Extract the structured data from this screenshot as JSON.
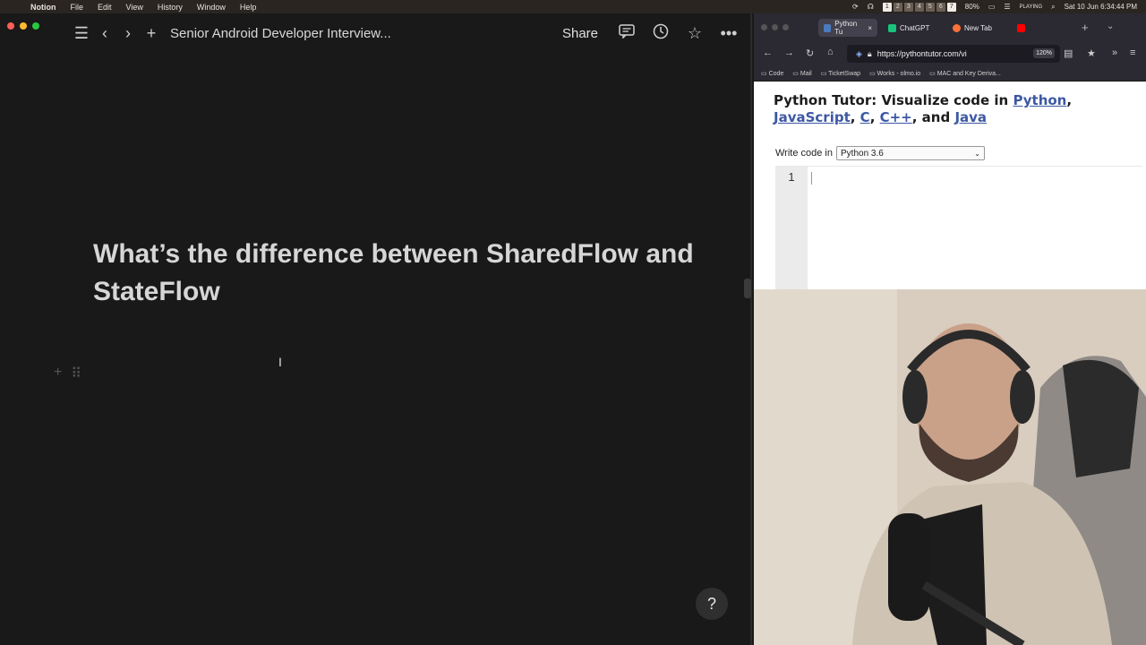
{
  "menubar": {
    "app": "Notion",
    "items": [
      "File",
      "Edit",
      "View",
      "History",
      "Window",
      "Help"
    ],
    "spaces": [
      "1",
      "2",
      "3",
      "4",
      "5",
      "6",
      "7"
    ],
    "battery": "80%",
    "now_playing": "PLAYING",
    "datetime": "Sat 10 Jun  6:34:44 PM"
  },
  "notion": {
    "breadcrumb": "Senior Android Developer Interview...",
    "share_label": "Share",
    "page_title": "What’s the difference between SharedFlow and StateFlow",
    "help_label": "?"
  },
  "browser": {
    "tabs": [
      "Python Tu",
      "ChatGPT",
      "New Tab"
    ],
    "url": "https://pythontutor.com/vi",
    "zoom": "120%",
    "bookmarks": [
      "Code",
      "Mail",
      "TicketSwap",
      "Works - olmo.io",
      "MAC and Key Deriva..."
    ],
    "page": {
      "title_prefix": "Python Tutor: Visualize code in ",
      "lang1": "Python",
      "lang2": "JavaScript",
      "lang3": "C",
      "lang4": "C++",
      "and": ", and ",
      "lang5": "Java",
      "write_code_label": "Write code in",
      "selected_language": "Python 3.6",
      "line_number": "1"
    }
  }
}
